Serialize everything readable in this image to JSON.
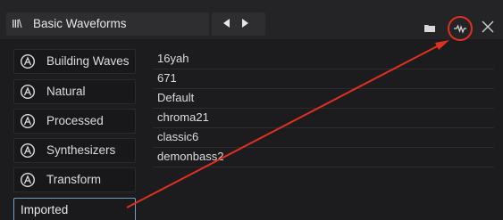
{
  "header": {
    "title": "Basic Waveforms",
    "library_icon_glyph": "III\\"
  },
  "sidebar": {
    "items": [
      {
        "label": "Building Waves"
      },
      {
        "label": "Natural"
      },
      {
        "label": "Processed"
      },
      {
        "label": "Synthesizers"
      },
      {
        "label": "Transform"
      }
    ],
    "imported_label": "Imported"
  },
  "list": {
    "rows": [
      "16yah",
      "671",
      "Default",
      "chroma21",
      "classic6",
      "demonbass2"
    ]
  },
  "annotation": {
    "color": "#e0301e"
  },
  "icons": {
    "library": "library-icon",
    "prev": "triangle-left-icon",
    "next": "triangle-right-icon",
    "folder": "folder-icon",
    "waveform": "waveform-icon",
    "close": "close-icon",
    "category": "arturia-logo-icon"
  }
}
